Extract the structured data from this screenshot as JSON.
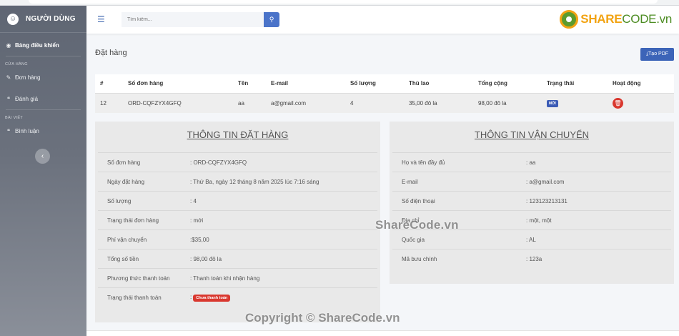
{
  "sidebar": {
    "brand": "NGƯỜI DÙNG",
    "brand_icon": "smile-logo-icon",
    "dashboard": "Bảng điều khiển",
    "section_store": "CỬA HÀNG",
    "orders": "Đơn hàng",
    "reviews": "Đánh giá",
    "section_posts": "BÀI VIẾT",
    "comments": "Bình luận",
    "collapse_icon": "chevron-left-icon"
  },
  "header": {
    "search_placeholder": "Tìm kiếm...",
    "search_icon": "search-icon",
    "logo_share": "SHARE",
    "logo_code": "CODE.vn"
  },
  "page": {
    "title": "Đặt hàng",
    "pdf_button": "⤓Tạo PDF"
  },
  "table": {
    "headers": [
      "#",
      "Số đơn hàng",
      "Tên",
      "E-mail",
      "Số lượng",
      "Thù lao",
      "Tổng cộng",
      "Trạng thái",
      "Hoạt động"
    ],
    "row": {
      "index": "12",
      "order_no": "ORD-CQFZYX4GFQ",
      "name": "aa",
      "email": "a@gmail.com",
      "quantity": "4",
      "fee": "35,00 đô la",
      "total": "98,00 đô la",
      "status": "MỚI"
    }
  },
  "order_info": {
    "title": "THÔNG TIN ĐẶT HÀNG",
    "rows": [
      {
        "label": "Số đơn hàng",
        "value": ": ORD-CQFZYX4GFQ"
      },
      {
        "label": "Ngày đặt hàng",
        "value": ": Thứ Ba, ngày 12 tháng 8 năm 2025 lúc 7:16 sáng"
      },
      {
        "label": "Số lượng",
        "value": ": 4"
      },
      {
        "label": "Trạng thái đơn hàng",
        "value": ": mới"
      },
      {
        "label": "Phí vận chuyển",
        "value": ":$35,00"
      },
      {
        "label": "Tổng số tiền",
        "value": ": 98,00 đô la"
      },
      {
        "label": "Phương thức thanh toán",
        "value": ": Thanh toán khi nhận hàng"
      },
      {
        "label": "Trạng thái thanh toán",
        "value": ":"
      }
    ],
    "payment_badge": "Chưa thanh toán"
  },
  "shipping_info": {
    "title": "THÔNG TIN VẬN CHUYỂN",
    "rows": [
      {
        "label": "Họ và tên đầy đủ",
        "value": ": aa"
      },
      {
        "label": "E-mail",
        "value": ": a@gmail.com"
      },
      {
        "label": "Số điện thoại",
        "value": ": 123123213131"
      },
      {
        "label": "Địa chỉ",
        "value": ": một, một"
      },
      {
        "label": "Quốc gia",
        "value": ": AL"
      },
      {
        "label": "Mã bưu chính",
        "value": ": 123a"
      }
    ]
  },
  "watermark": "ShareCode.vn",
  "copyright": "Copyright © ShareCode.vn"
}
